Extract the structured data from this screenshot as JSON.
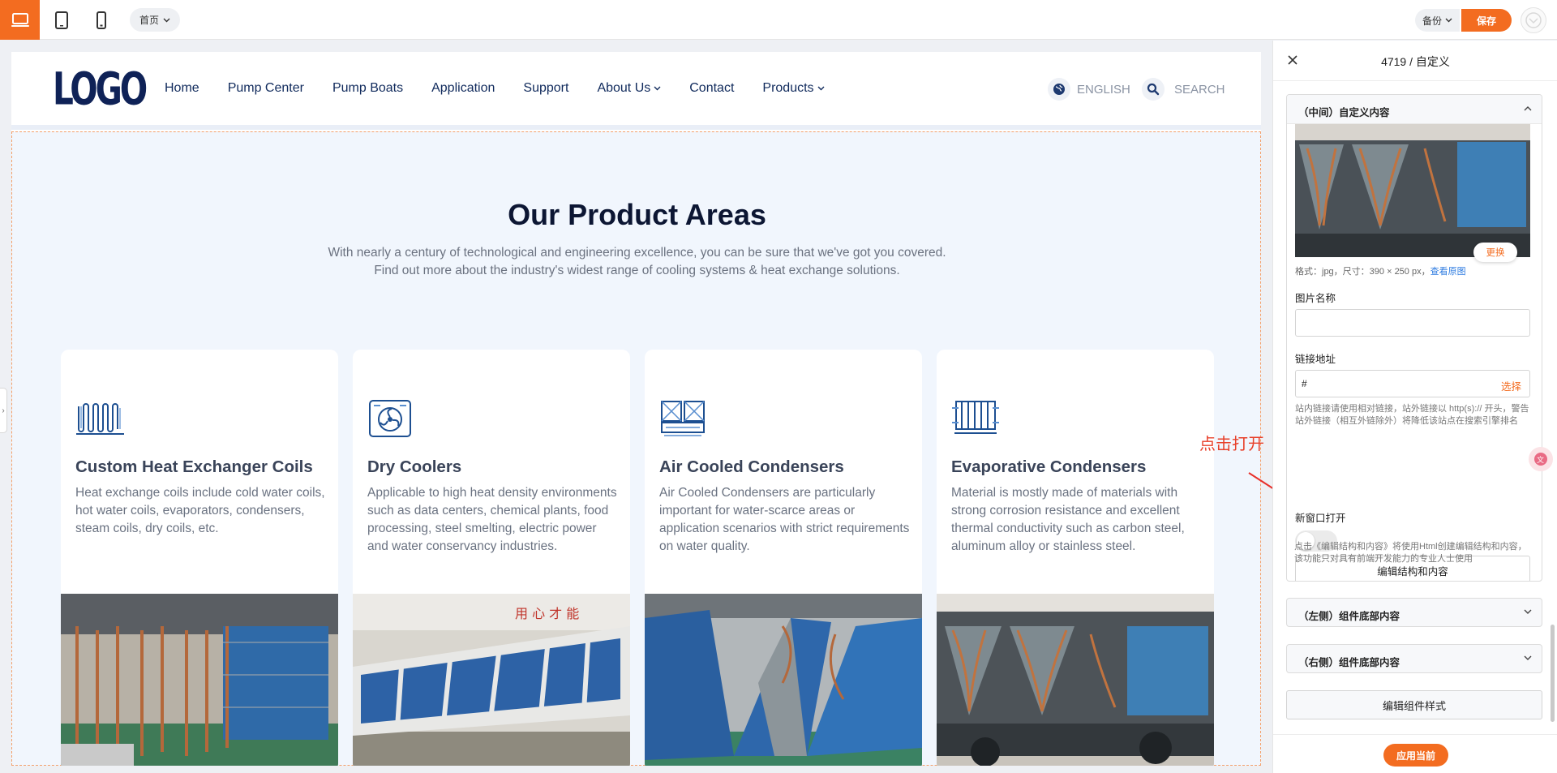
{
  "topbar": {
    "page_select": "首页",
    "backup": "备份",
    "save": "保存"
  },
  "site": {
    "logo": "LOGO",
    "nav": [
      "Home",
      "Pump Center",
      "Pump Boats",
      "Application",
      "Support",
      "About Us",
      "Contact",
      "Products"
    ],
    "language": "ENGLISH",
    "search": "SEARCH"
  },
  "section": {
    "title": "Our Product Areas",
    "subtitle_line1": "With nearly a century of technological and engineering excellence, you can be sure that we've got you covered.",
    "subtitle_line2": "Find out more about the industry's widest range of cooling systems & heat exchange solutions.",
    "cards": [
      {
        "title": "Custom Heat Exchanger Coils",
        "text": "Heat exchange coils include cold water coils, hot water coils, evaporators, condensers, steam coils, dry coils, etc.",
        "icon": "coil-icon"
      },
      {
        "title": "Dry Coolers",
        "text": "Applicable to high heat density environments such as data centers, chemical plants, food processing, steel smelting, electric power and water conservancy industries.",
        "icon": "dry-cooler-icon"
      },
      {
        "title": "Air Cooled Condensers",
        "text": "Air Cooled Condensers are particularly important for water-scarce areas or application scenarios with strict requirements on water quality.",
        "icon": "air-condenser-icon"
      },
      {
        "title": "Evaporative Condensers",
        "text": "Material is mostly made of materials with strong corrosion resistance and excellent thermal conductivity such as carbon steel, aluminum alloy or stainless steel.",
        "icon": "evaporative-condenser-icon"
      }
    ]
  },
  "annotation": {
    "text": "点击打开"
  },
  "panel": {
    "title": "4719 / 自定义",
    "group_title": "（中间）自定义内容",
    "replace": "更换",
    "format_text": "格式：jpg，尺寸：390 × 250 px，",
    "view_original": "查看原图",
    "image_name_label": "图片名称",
    "image_name_value": "",
    "link_label": "链接地址",
    "link_value": "#",
    "link_select": "选择",
    "link_hint": "站内链接请使用相对链接，站外链接以 http(s):// 开头，警告站外链接（相互外链除外）将降低该站点在搜索引擎排名",
    "new_window_label": "新窗口打开",
    "edit_structure": "编辑结构和内容",
    "edit_hint": "点击《编辑结构和内容》将使用Html创建编辑结构和内容，该功能只对具有前端开发能力的专业人士使用",
    "left_bottom": "（左侧）组件底部内容",
    "right_bottom": "（右侧）组件底部内容",
    "edit_style": "编辑组件样式",
    "apply": "应用当前"
  },
  "colors": {
    "accent": "#f36c20",
    "navy": "#0f2257",
    "annotation": "#e8302a"
  }
}
